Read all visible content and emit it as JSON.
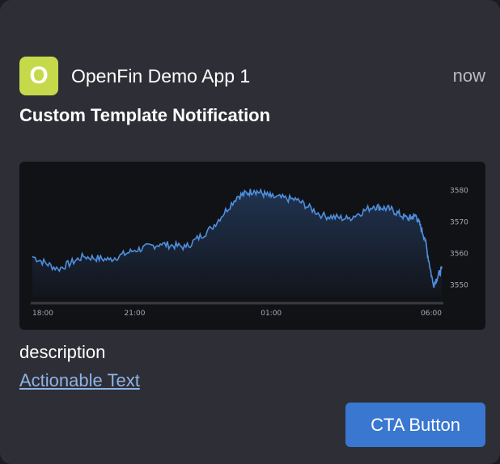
{
  "notification": {
    "app_icon_letter": "O",
    "app_name": "OpenFin Demo App 1",
    "timestamp": "now",
    "title": "Custom Template Notification",
    "description": "description",
    "action_text": "Actionable Text",
    "cta_label": "CTA Button"
  },
  "colors": {
    "card_bg": "#2e2f36",
    "app_icon_bg": "#c5d94a",
    "link": "#8fb2e6",
    "cta_bg": "#3a77d0",
    "chart_line": "#4f8fe0",
    "chart_bg": "#111216"
  },
  "chart_data": {
    "type": "area",
    "xlabel": "",
    "ylabel": "",
    "x_ticks": [
      "18:00",
      "21:00",
      "01:00",
      "06:00"
    ],
    "y_ticks": [
      3550,
      3560,
      3570,
      3580
    ],
    "ylim": [
      3546,
      3584
    ],
    "grid": false,
    "x": [
      "18:00",
      "18:45",
      "19:30",
      "20:15",
      "21:00",
      "21:45",
      "22:30",
      "23:15",
      "00:00",
      "00:30",
      "01:00",
      "01:45",
      "02:30",
      "03:15",
      "04:00",
      "04:30",
      "05:00",
      "05:15",
      "05:30",
      "05:45",
      "06:00"
    ],
    "values": [
      3559,
      3555,
      3559,
      3558,
      3561,
      3563,
      3562,
      3568,
      3578,
      3580,
      3578,
      3577,
      3572,
      3571,
      3575,
      3574,
      3571,
      3572,
      3565,
      3550,
      3555
    ]
  }
}
